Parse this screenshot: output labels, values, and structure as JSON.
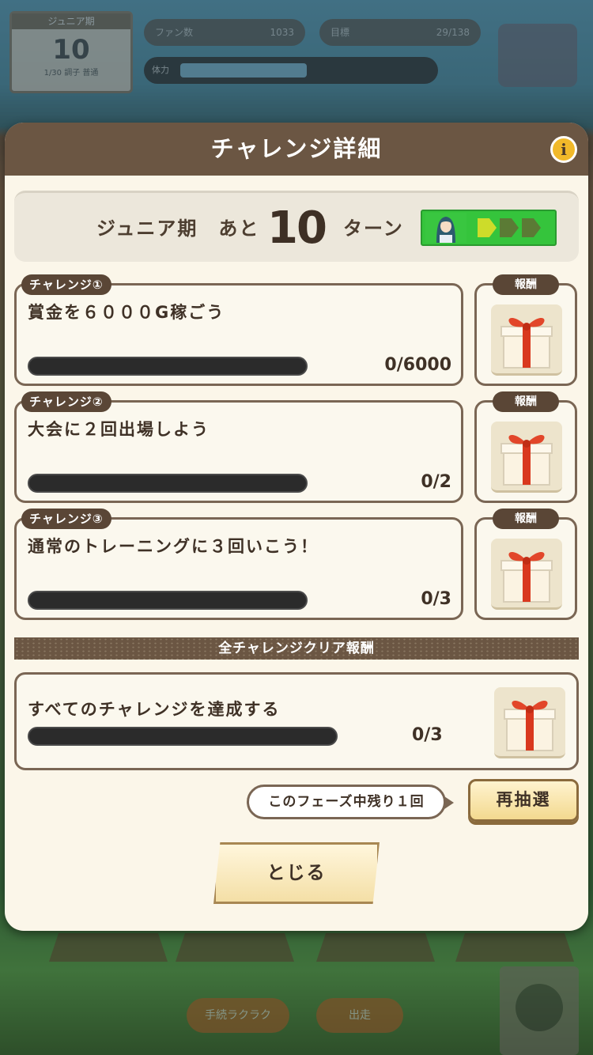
{
  "background": {
    "turn_box": {
      "header": "ジュニア期",
      "number": "10",
      "footer": "1/30  調子  普通"
    },
    "pill_fans": {
      "label": "ファン数",
      "value": "1033"
    },
    "pill_skill": {
      "label": "目標",
      "value": "29/138"
    },
    "bar_label": "体力",
    "chips": [
      "手続ラクラク",
      "出走"
    ]
  },
  "modal": {
    "title": "チャレンジ詳細",
    "info_icon": "i",
    "turn": {
      "prefix": "ジュニア期　あと",
      "number": "10",
      "suffix": "ターン"
    }
  },
  "challenges": [
    {
      "tab": "チャレンジ①",
      "text": "賞金を６０００G稼ごう",
      "progress": 0,
      "count": "0/6000",
      "reward_label": "報酬"
    },
    {
      "tab": "チャレンジ②",
      "text": "大会に２回出場しよう",
      "progress": 0,
      "count": "0/2",
      "reward_label": "報酬"
    },
    {
      "tab": "チャレンジ③",
      "text": "通常のトレーニングに３回いこう！",
      "progress": 0,
      "count": "0/3",
      "reward_label": "報酬"
    }
  ],
  "all_clear": {
    "header": "全チャレンジクリア報酬",
    "text": "すべてのチャレンジを達成する",
    "progress": 0,
    "count": "0/3"
  },
  "remain_text": "このフェーズ中残り１回",
  "redraw_label": "再抽選",
  "close_label": "とじる",
  "colors": {
    "header_brown": "#6b5643",
    "phase_green": "#35c43c",
    "gift_red": "#d9381e"
  }
}
